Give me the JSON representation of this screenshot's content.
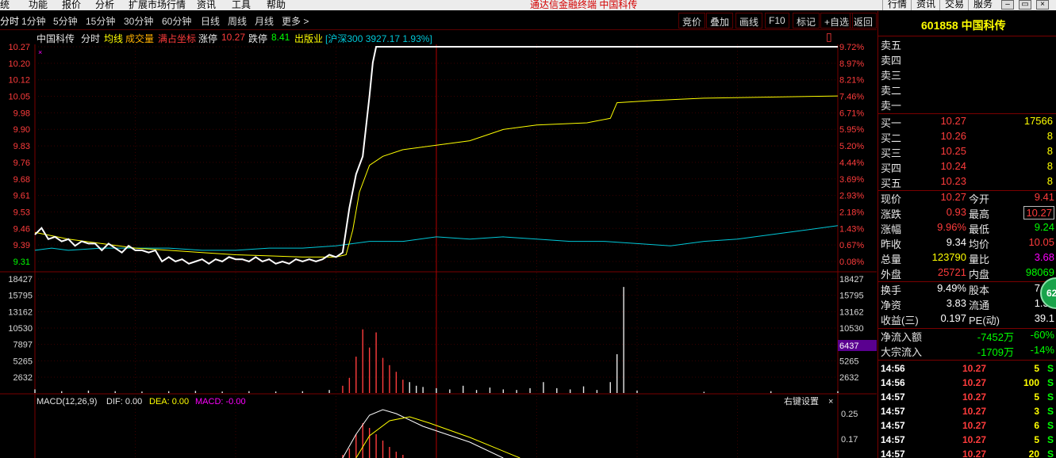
{
  "menu": {
    "items": [
      "统",
      "功能",
      "报价",
      "分析",
      "扩展市场行情",
      "资讯",
      "工具",
      "帮助"
    ],
    "window_title": "通达信金融终端   中国科传",
    "right_buttons": [
      "行情",
      "资讯",
      "交易",
      "服务"
    ]
  },
  "periods": [
    "分时",
    "1分钟",
    "5分钟",
    "15分钟",
    "30分钟",
    "60分钟",
    "日线",
    "周线",
    "月线",
    "更多 >"
  ],
  "toolbar": [
    "竞价",
    "叠加",
    "画线",
    "F10",
    "标记",
    "+自选",
    "返回"
  ],
  "info": {
    "name": "中国科传",
    "mode": "分时",
    "avg_label": "均线",
    "vol_label": "成交量",
    "coord_label": "满占坐标",
    "zt_label": "涨停",
    "zt_value": "10.27",
    "dt_label": "跌停",
    "dt_value": "8.41",
    "sector": "出版业",
    "index": "沪深300 3927.17 1.93%"
  },
  "macd": {
    "label": "MACD(12,26,9)",
    "dif": "DIF: 0.00",
    "dea": "DEA: 0.00",
    "macd": "MACD: -0.00",
    "settings": "右键设置",
    "close": "×"
  },
  "vol_marker": "6437",
  "colors": {
    "price_line": "#ffffff",
    "avg_line": "#ffff00",
    "index_line": "#00c8d8",
    "up": "#ff3c3c",
    "down": "#00ff00",
    "grid": "#7a0000"
  },
  "chart_data": {
    "type": "line",
    "y_price_ticks": [
      "10.27",
      "10.20",
      "10.12",
      "10.05",
      "9.98",
      "9.90",
      "9.83",
      "9.76",
      "9.68",
      "9.61",
      "9.53",
      "9.46",
      "9.39",
      "9.31"
    ],
    "y_pct_ticks": [
      "9.72%",
      "8.97%",
      "8.21%",
      "7.46%",
      "6.71%",
      "5.95%",
      "5.20%",
      "4.44%",
      "3.69%",
      "2.93%",
      "2.18%",
      "1.43%",
      "0.67%",
      "0.08%"
    ],
    "ylim_price": [
      9.31,
      10.27
    ],
    "vol_ticks": [
      "18427",
      "15795",
      "13162",
      "10530",
      "7897",
      "5265",
      "2632"
    ],
    "vol_max": 18427,
    "macd_ticks": [
      "0.25",
      "0.17"
    ],
    "x_minutes": [
      0,
      240
    ],
    "series": [
      {
        "name": "中国科传",
        "values": [
          [
            0,
            9.43
          ],
          [
            2,
            9.46
          ],
          [
            4,
            9.41
          ],
          [
            6,
            9.42
          ],
          [
            8,
            9.4
          ],
          [
            10,
            9.41
          ],
          [
            12,
            9.38
          ],
          [
            14,
            9.4
          ],
          [
            16,
            9.39
          ],
          [
            18,
            9.39
          ],
          [
            20,
            9.36
          ],
          [
            22,
            9.39
          ],
          [
            24,
            9.37
          ],
          [
            26,
            9.35
          ],
          [
            28,
            9.38
          ],
          [
            30,
            9.36
          ],
          [
            32,
            9.36
          ],
          [
            34,
            9.35
          ],
          [
            36,
            9.36
          ],
          [
            38,
            9.31
          ],
          [
            40,
            9.33
          ],
          [
            42,
            9.31
          ],
          [
            44,
            9.32
          ],
          [
            46,
            9.3
          ],
          [
            48,
            9.31
          ],
          [
            50,
            9.32
          ],
          [
            52,
            9.3
          ],
          [
            54,
            9.32
          ],
          [
            56,
            9.31
          ],
          [
            58,
            9.33
          ],
          [
            60,
            9.32
          ],
          [
            62,
            9.32
          ],
          [
            64,
            9.31
          ],
          [
            66,
            9.33
          ],
          [
            68,
            9.31
          ],
          [
            70,
            9.32
          ],
          [
            72,
            9.3
          ],
          [
            74,
            9.31
          ],
          [
            76,
            9.3
          ],
          [
            78,
            9.32
          ],
          [
            80,
            9.31
          ],
          [
            82,
            9.32
          ],
          [
            84,
            9.31
          ],
          [
            86,
            9.32
          ],
          [
            88,
            9.34
          ],
          [
            90,
            9.33
          ],
          [
            92,
            9.35
          ],
          [
            94,
            9.55
          ],
          [
            96,
            9.7
          ],
          [
            98,
            9.78
          ],
          [
            100,
            10.05
          ],
          [
            101,
            10.2
          ],
          [
            102,
            10.27
          ],
          [
            240,
            10.27
          ]
        ]
      },
      {
        "name": "均线",
        "values": [
          [
            0,
            9.44
          ],
          [
            10,
            9.41
          ],
          [
            20,
            9.39
          ],
          [
            30,
            9.37
          ],
          [
            40,
            9.36
          ],
          [
            50,
            9.35
          ],
          [
            60,
            9.34
          ],
          [
            70,
            9.335
          ],
          [
            80,
            9.33
          ],
          [
            90,
            9.33
          ],
          [
            93,
            9.34
          ],
          [
            95,
            9.45
          ],
          [
            97,
            9.62
          ],
          [
            100,
            9.74
          ],
          [
            104,
            9.78
          ],
          [
            110,
            9.81
          ],
          [
            120,
            9.83
          ],
          [
            130,
            9.85
          ],
          [
            140,
            9.9
          ],
          [
            150,
            9.92
          ],
          [
            165,
            9.93
          ],
          [
            172,
            9.95
          ],
          [
            174,
            10.02
          ],
          [
            185,
            10.03
          ],
          [
            200,
            10.04
          ],
          [
            220,
            10.045
          ],
          [
            240,
            10.05
          ]
        ]
      },
      {
        "name": "沪深300",
        "values": [
          [
            0,
            9.36
          ],
          [
            5,
            9.37
          ],
          [
            10,
            9.36
          ],
          [
            20,
            9.37
          ],
          [
            30,
            9.37
          ],
          [
            40,
            9.37
          ],
          [
            50,
            9.36
          ],
          [
            60,
            9.36
          ],
          [
            70,
            9.37
          ],
          [
            80,
            9.37
          ],
          [
            90,
            9.38
          ],
          [
            100,
            9.4
          ],
          [
            110,
            9.4
          ],
          [
            120,
            9.42
          ],
          [
            130,
            9.41
          ],
          [
            140,
            9.42
          ],
          [
            150,
            9.41
          ],
          [
            160,
            9.4
          ],
          [
            170,
            9.4
          ],
          [
            180,
            9.39
          ],
          [
            190,
            9.38
          ],
          [
            200,
            9.4
          ],
          [
            210,
            9.41
          ],
          [
            220,
            9.43
          ],
          [
            230,
            9.45
          ],
          [
            240,
            9.47
          ]
        ]
      }
    ],
    "volume": [
      [
        0,
        600
      ],
      [
        8,
        300
      ],
      [
        16,
        400
      ],
      [
        24,
        300
      ],
      [
        32,
        250
      ],
      [
        40,
        300
      ],
      [
        48,
        350
      ],
      [
        56,
        250
      ],
      [
        64,
        300
      ],
      [
        72,
        250
      ],
      [
        80,
        300
      ],
      [
        88,
        500
      ],
      [
        92,
        1200
      ],
      [
        94,
        2500
      ],
      [
        96,
        6000
      ],
      [
        98,
        10500
      ],
      [
        100,
        7500
      ],
      [
        102,
        10000
      ],
      [
        104,
        5800
      ],
      [
        106,
        4600
      ],
      [
        108,
        3500
      ],
      [
        110,
        2200
      ],
      [
        112,
        1800
      ],
      [
        114,
        1200
      ],
      [
        116,
        1000
      ],
      [
        120,
        800
      ],
      [
        124,
        600
      ],
      [
        128,
        1200
      ],
      [
        132,
        500
      ],
      [
        136,
        900
      ],
      [
        140,
        600
      ],
      [
        144,
        500
      ],
      [
        148,
        800
      ],
      [
        152,
        1800
      ],
      [
        156,
        800
      ],
      [
        160,
        600
      ],
      [
        164,
        1100
      ],
      [
        168,
        500
      ],
      [
        172,
        1800
      ],
      [
        174,
        6400
      ],
      [
        176,
        17500
      ],
      [
        180,
        400
      ],
      [
        200,
        200
      ],
      [
        220,
        300
      ],
      [
        240,
        300
      ]
    ],
    "title": ""
  },
  "panel": {
    "code": "601858",
    "name": "中国科传",
    "sell": [
      "卖五",
      "卖四",
      "卖三",
      "卖二",
      "卖一"
    ],
    "buy": [
      {
        "label": "买一",
        "price": "10.27",
        "vol": "17566"
      },
      {
        "label": "买二",
        "price": "10.26",
        "vol": "8"
      },
      {
        "label": "买三",
        "price": "10.25",
        "vol": "8"
      },
      {
        "label": "买四",
        "price": "10.24",
        "vol": "8"
      },
      {
        "label": "买五",
        "price": "10.23",
        "vol": "8"
      }
    ],
    "stats": [
      {
        "l1": "现价",
        "v1": "10.27",
        "l2": "今开",
        "v2": "9.41"
      },
      {
        "l1": "涨跌",
        "v1": "0.93",
        "l2": "最高",
        "v2": "10.27"
      },
      {
        "l1": "涨幅",
        "v1": "9.96%",
        "l2": "最低",
        "v2": "9.24"
      },
      {
        "l1": "昨收",
        "v1": "9.34",
        "l2": "均价",
        "v2": "10.05"
      },
      {
        "l1": "总量",
        "v1": "123790",
        "l2": "量比",
        "v2": "3.68"
      },
      {
        "l1": "外盘",
        "v1": "25721",
        "l2": "内盘",
        "v2": "98069"
      }
    ],
    "fin": [
      {
        "l1": "换手",
        "v1": "9.49%",
        "l2": "股本",
        "v2": "7.91"
      },
      {
        "l1": "净资",
        "v1": "3.83",
        "l2": "流通",
        "v2": "1.31"
      },
      {
        "l1": "收益(三)",
        "v1": "0.197",
        "l2": "PE(动)",
        "v2": "39.1"
      }
    ],
    "flow": [
      {
        "label": "净流入额",
        "value": "-7452万",
        "pct": "-60%"
      },
      {
        "label": "大宗流入",
        "value": "-1709万",
        "pct": "-14%"
      }
    ],
    "ticks": [
      {
        "time": "14:56",
        "price": "10.27",
        "vol": "5",
        "side": "S"
      },
      {
        "time": "14:56",
        "price": "10.27",
        "vol": "100",
        "side": "S"
      },
      {
        "time": "14:57",
        "price": "10.27",
        "vol": "5",
        "side": "S"
      },
      {
        "time": "14:57",
        "price": "10.27",
        "vol": "3",
        "side": "S"
      },
      {
        "time": "14:57",
        "price": "10.27",
        "vol": "6",
        "side": "S"
      },
      {
        "time": "14:57",
        "price": "10.27",
        "vol": "5",
        "side": "S"
      },
      {
        "time": "14:57",
        "price": "10.27",
        "vol": "20",
        "side": "S"
      }
    ],
    "badge": "62"
  }
}
